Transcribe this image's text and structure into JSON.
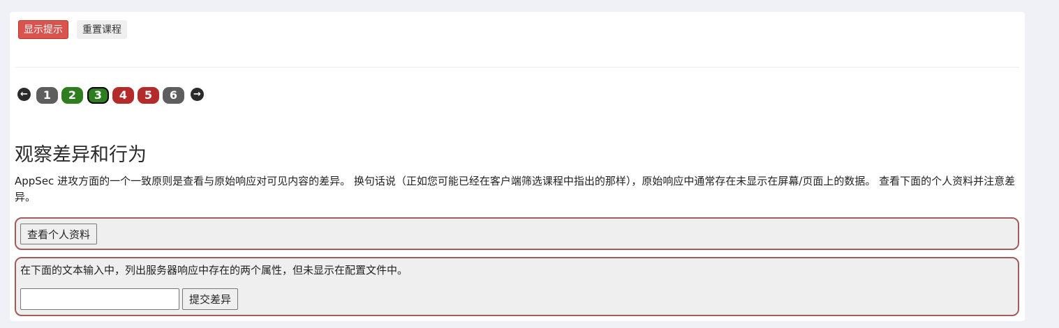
{
  "toolbar": {
    "hint_label": "显示提示",
    "reset_label": "重置课程"
  },
  "pagination": {
    "prev_icon": "arrow-left-icon",
    "next_icon": "arrow-right-icon",
    "pages": [
      {
        "label": "1",
        "state": "unvisited",
        "color": "#5e5e5e"
      },
      {
        "label": "2",
        "state": "solved",
        "color": "#2e7d1f"
      },
      {
        "label": "3",
        "state": "current",
        "color": "#2e7d1f"
      },
      {
        "label": "4",
        "state": "unsolved",
        "color": "#b42b2b"
      },
      {
        "label": "5",
        "state": "unsolved",
        "color": "#b42b2b"
      },
      {
        "label": "6",
        "state": "unvisited",
        "color": "#5e5e5e"
      }
    ]
  },
  "lesson": {
    "title": "观察差异和行为",
    "description": "AppSec 进攻方面的一个一致原则是查看与原始响应对可见内容的差异。 换句话说（正如您可能已经在客户端筛选课程中指出的那样），原始响应中通常存在未显示在屏幕/页面上的数据。 查看下面的个人资料并注意差异。"
  },
  "profile_form": {
    "button_label": "查看个人资料"
  },
  "diff_form": {
    "instruction": "在下面的文本输入中，列出服务器响应中存在的两个属性，但未显示在配置文件中。",
    "input_value": "",
    "submit_label": "提交差异"
  },
  "colors": {
    "accent_red": "#d9534f",
    "box_border": "#a05c5c"
  }
}
